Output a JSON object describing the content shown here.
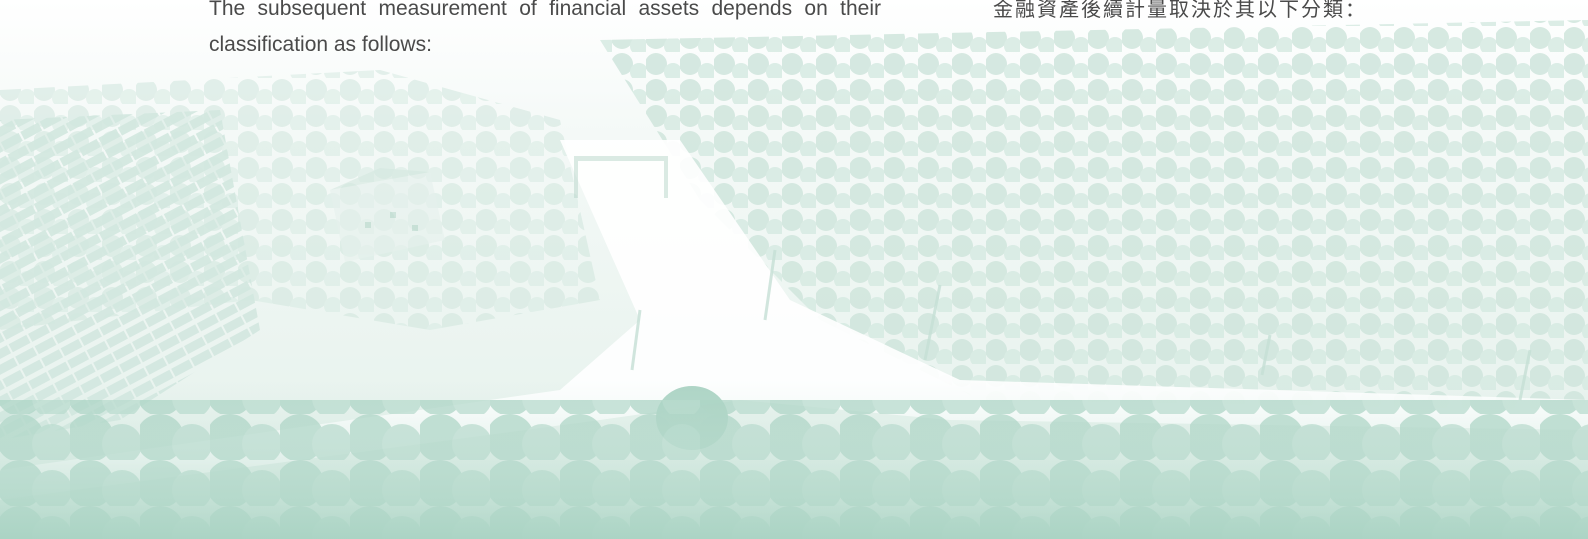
{
  "document": {
    "paragraph_en": "The subsequent measurement of financial assets depends on their classification as follows:",
    "paragraph_zh": "金融資產後續計量取決於其以下分類："
  },
  "colors": {
    "text": "#4a4a4a",
    "background_tint": "#cfe6dd",
    "tree_tint": "#8fc4b2"
  }
}
